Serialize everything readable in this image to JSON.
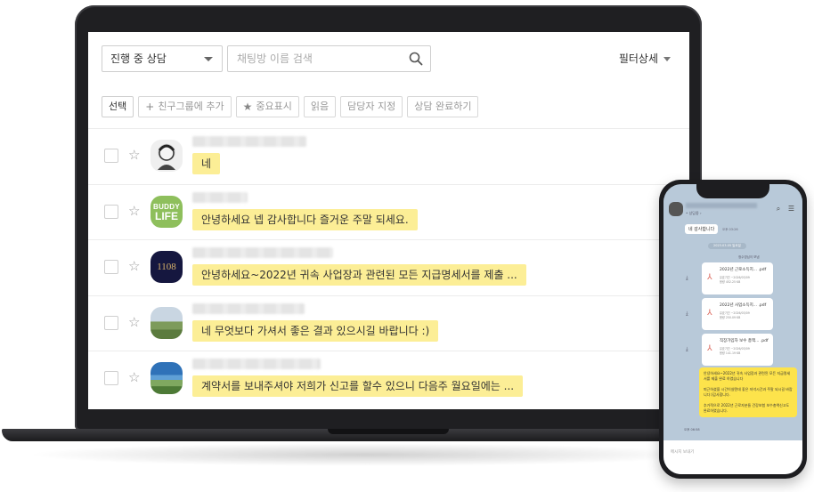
{
  "toolbar": {
    "status_select": "진행 중 상담",
    "search_placeholder": "채팅방 이름 검색",
    "filter_detail": "필터상세"
  },
  "actions": [
    {
      "label": "선택",
      "glyph": ""
    },
    {
      "label": "친구그룹에 추가",
      "glyph": "+"
    },
    {
      "label": "중요표시",
      "glyph": "★"
    },
    {
      "label": "읽음",
      "glyph": ""
    },
    {
      "label": "담당자 지정",
      "glyph": ""
    },
    {
      "label": "상담 완료하기",
      "glyph": ""
    }
  ],
  "chats": [
    {
      "avatar": "profile-photo-avatar",
      "message": "네"
    },
    {
      "avatar_lines": [
        "BUDDY",
        "LIFE"
      ],
      "message": "안녕하세요 넵 감사합니다 즐거운 주말 되세요."
    },
    {
      "avatar_text": "1108",
      "message": "안녕하세요~2022년 귀속 사업장과 관련된 모든 지급명세서를 제출 ..."
    },
    {
      "avatar": "field-photo-avatar",
      "message": "네 무엇보다 가셔서 좋은 결과 있으시길 바랍니다 :)"
    },
    {
      "avatar": "sea-photo-avatar",
      "message": "계약서를 보내주셔야 저희가 신고를 할수 있으니 다음주 월요일에는 ..."
    }
  ],
  "phone": {
    "header_icons": "⌕ ☰",
    "header_sub": "• 상담중 ›",
    "incoming_message": "네 감사합니다",
    "incoming_time": "오후 03:26",
    "date_divider": "2023.03.05 일요일",
    "system_note": "정수영님이 보냄",
    "files": [
      {
        "name": "2022년 근로소득지... .pdf",
        "expiry": "유효기간 ~2026/03/09",
        "size": "용량 452.25 KB"
      },
      {
        "name": "2022년 사업소득지... .pdf",
        "expiry": "유효기간 ~2026/03/09",
        "size": "용량 250.09 KB"
      },
      {
        "name": "직장가입자 보수 총액... .pdf",
        "expiry": "유효기간 ~2026/03/09",
        "size": "용량 141.19 KB"
      }
    ],
    "outgoing_p1": "안녕하세요~2022년 귀속 사업장과 관련된 모든 지급명세서를 제출 완료 하였습니다",
    "outgoing_p2": "퇴근하셨을 시간이실텐데 좋은 저녁시간과 주말 되시길 바랍니다:)감사합니다.",
    "outgoing_p3": "추가적으로 2022년 근로자분들 건강보험 보수총액신고도 완료하였습니다.",
    "outgoing_time": "오후 06:58",
    "input_placeholder": "메시지 보내기",
    "download_glyph": "⤓",
    "pdf_glyph": "⅄"
  }
}
